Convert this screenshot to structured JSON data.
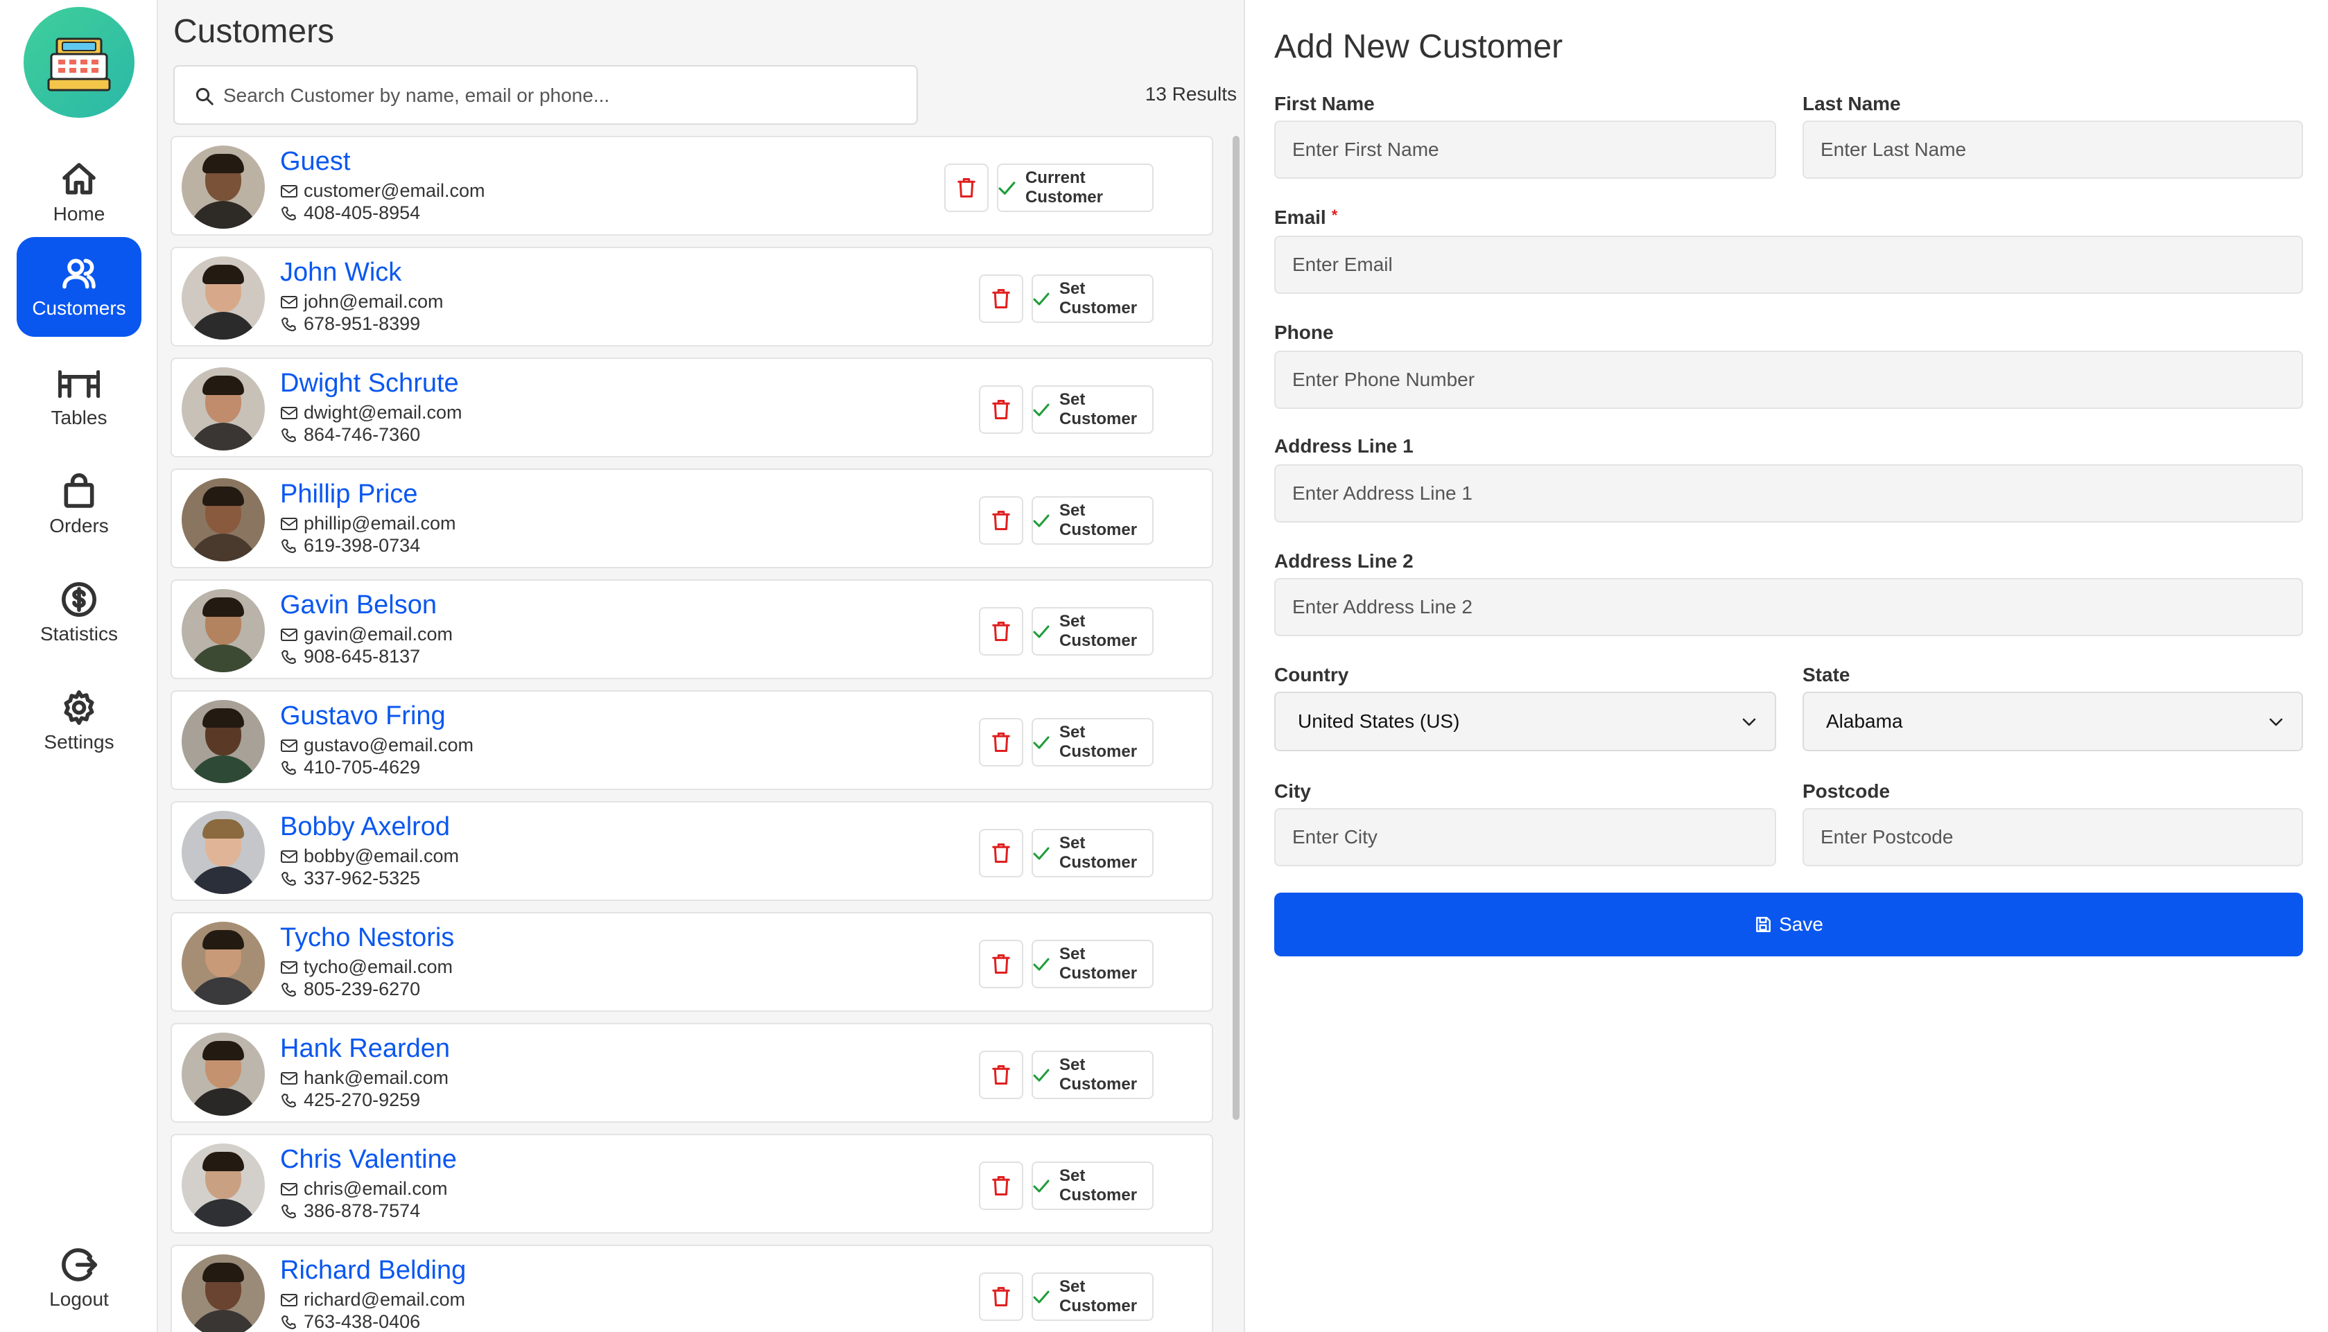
{
  "sidebar": {
    "logo": "cash-register-icon",
    "items": [
      {
        "label": "Home",
        "icon": "home-icon",
        "active": false
      },
      {
        "label": "Customers",
        "icon": "users-icon",
        "active": true
      },
      {
        "label": "Tables",
        "icon": "table-icon",
        "active": false
      },
      {
        "label": "Orders",
        "icon": "shopping-bag-icon",
        "active": false
      },
      {
        "label": "Statistics",
        "icon": "dollar-circle-icon",
        "active": false
      },
      {
        "label": "Settings",
        "icon": "gear-icon",
        "active": false
      }
    ],
    "logout": {
      "label": "Logout",
      "icon": "logout-icon"
    }
  },
  "customers": {
    "title": "Customers",
    "search_placeholder": "Search Customer by name, email or phone...",
    "results": "13 Results",
    "list": [
      {
        "name": "Guest",
        "email": "customer@email.com",
        "phone": "408-405-8954",
        "action": "Current Customer"
      },
      {
        "name": "John Wick",
        "email": "john@email.com",
        "phone": "678-951-8399",
        "action": "Set Customer"
      },
      {
        "name": "Dwight Schrute",
        "email": "dwight@email.com",
        "phone": "864-746-7360",
        "action": "Set Customer"
      },
      {
        "name": "Phillip Price",
        "email": "phillip@email.com",
        "phone": "619-398-0734",
        "action": "Set Customer"
      },
      {
        "name": "Gavin Belson",
        "email": "gavin@email.com",
        "phone": "908-645-8137",
        "action": "Set Customer"
      },
      {
        "name": "Gustavo Fring",
        "email": "gustavo@email.com",
        "phone": "410-705-4629",
        "action": "Set Customer"
      },
      {
        "name": "Bobby Axelrod",
        "email": "bobby@email.com",
        "phone": "337-962-5325",
        "action": "Set Customer"
      },
      {
        "name": "Tycho Nestoris",
        "email": "tycho@email.com",
        "phone": "805-239-6270",
        "action": "Set Customer"
      },
      {
        "name": "Hank Rearden",
        "email": "hank@email.com",
        "phone": "425-270-9259",
        "action": "Set Customer"
      },
      {
        "name": "Chris Valentine",
        "email": "chris@email.com",
        "phone": "386-878-7574",
        "action": "Set Customer"
      },
      {
        "name": "Richard Belding",
        "email": "richard@email.com",
        "phone": "763-438-0406",
        "action": "Set Customer"
      }
    ]
  },
  "form": {
    "title": "Add New Customer",
    "first_name": {
      "label": "First Name",
      "placeholder": "Enter First Name"
    },
    "last_name": {
      "label": "Last Name",
      "placeholder": "Enter Last Name"
    },
    "email": {
      "label": "Email",
      "required_mark": "*",
      "placeholder": "Enter Email"
    },
    "phone": {
      "label": "Phone",
      "placeholder": "Enter Phone Number"
    },
    "address1": {
      "label": "Address Line 1",
      "placeholder": "Enter Address Line 1"
    },
    "address2": {
      "label": "Address Line 2",
      "placeholder": "Enter Address Line 2"
    },
    "country": {
      "label": "Country",
      "value": "United States (US)"
    },
    "state": {
      "label": "State",
      "value": "Alabama"
    },
    "city": {
      "label": "City",
      "placeholder": "Enter City"
    },
    "postcode": {
      "label": "Postcode",
      "placeholder": "Enter Postcode"
    },
    "save_label": "Save"
  },
  "colors": {
    "accent": "#0a57f0",
    "delete": "#e02020",
    "check": "#1f9d3a"
  }
}
